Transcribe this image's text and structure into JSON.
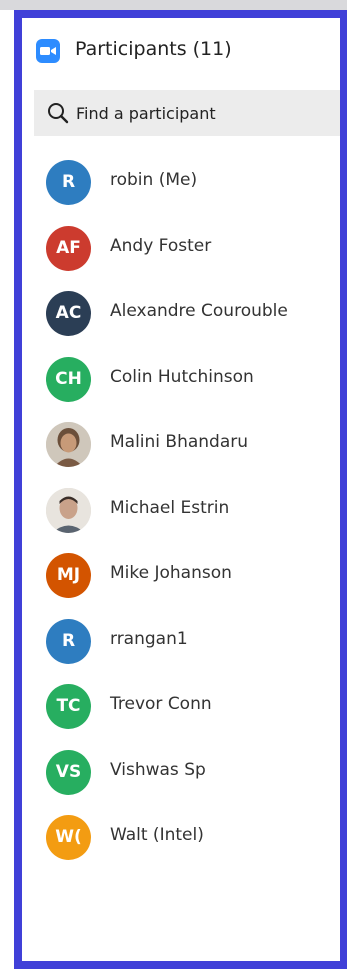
{
  "header": {
    "title": "Participants (11)",
    "app_icon": "zoom-video-camera-icon",
    "accent_color": "#2d8cff"
  },
  "search": {
    "icon": "search-icon",
    "placeholder": "Find a participant"
  },
  "frame_color": "#4040d8",
  "participants": [
    {
      "initials": "R",
      "name": "robin (Me)",
      "color": "#2e7dc0",
      "photo": false
    },
    {
      "initials": "AF",
      "name": "Andy Foster",
      "color": "#cc3b2e",
      "photo": false
    },
    {
      "initials": "AC",
      "name": "Alexandre Courouble",
      "color": "#2b3e55",
      "photo": false
    },
    {
      "initials": "CH",
      "name": "Colin Hutchinson",
      "color": "#27ae60",
      "photo": false
    },
    {
      "initials": "",
      "name": "Malini Bhandaru",
      "color": "#b89a7a",
      "photo": true
    },
    {
      "initials": "",
      "name": "Michael Estrin",
      "color": "#c9a48a",
      "photo": true
    },
    {
      "initials": "MJ",
      "name": "Mike Johanson",
      "color": "#d35400",
      "photo": false
    },
    {
      "initials": "R",
      "name": "rrangan1",
      "color": "#2e7dc0",
      "photo": false
    },
    {
      "initials": "TC",
      "name": "Trevor Conn",
      "color": "#27ae60",
      "photo": false
    },
    {
      "initials": "VS",
      "name": "Vishwas Sp",
      "color": "#27ae60",
      "photo": false
    },
    {
      "initials": "W(",
      "name": "Walt (Intel)",
      "color": "#f39c12",
      "photo": false
    }
  ]
}
